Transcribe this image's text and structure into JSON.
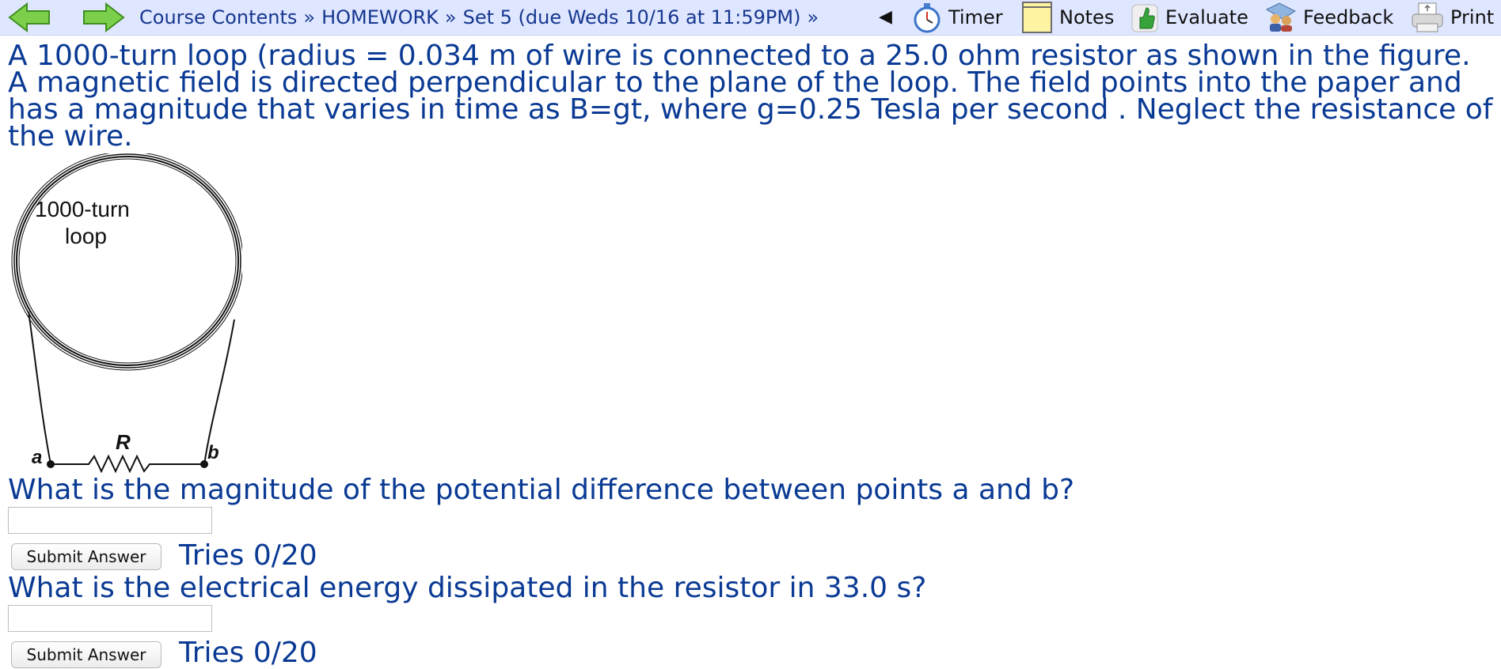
{
  "nav": {
    "breadcrumb": [
      "Course Contents",
      "HOMEWORK",
      "Set 5 (due Weds 10/16 at 11:59PM)"
    ],
    "separator": "»",
    "trailing": "»",
    "prev_symbol": "◀"
  },
  "toolbar": {
    "timer": "Timer",
    "notes": "Notes",
    "evaluate": "Evaluate",
    "feedback": "Feedback",
    "print": "Print"
  },
  "problem": {
    "text": "A 1000-turn loop (radius = 0.034 m of wire is connected to a 25.0 ohm resistor as shown in the figure. A magnetic field is directed perpendicular to the plane of the loop. The field points into the paper and has a magnitude that varies in time as B=gt, where g=0.25 Tesla per second . Neglect the resistance of the wire."
  },
  "figure": {
    "loop_label_1": "1000-turn",
    "loop_label_2": "loop",
    "resistor_label": "R",
    "point_a": "a",
    "point_b": "b"
  },
  "questions": [
    {
      "text": "What is the magnitude of the potential difference between points a and b?",
      "input_value": "",
      "submit_label": "Submit Answer",
      "tries": "Tries 0/20"
    },
    {
      "text": "What is the electrical energy dissipated in the resistor in 33.0 s?",
      "input_value": "",
      "submit_label": "Submit Answer",
      "tries": "Tries 0/20"
    }
  ]
}
